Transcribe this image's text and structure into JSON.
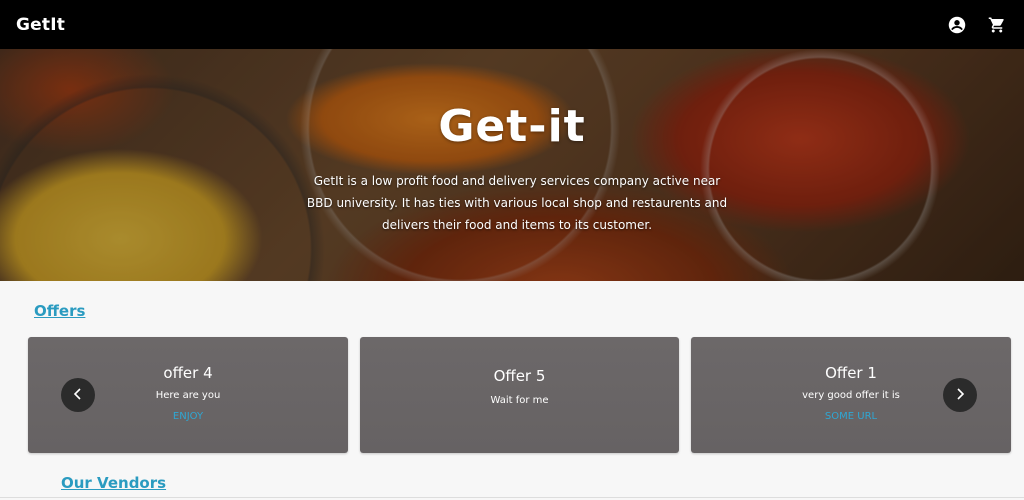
{
  "navbar": {
    "brand": "GetIt",
    "icons": [
      "account-circle-icon",
      "shopping-cart-icon"
    ]
  },
  "hero": {
    "title": "Get-it",
    "description": "GetIt is a low profit food and delivery services company active near BBD university. It has ties with various local shop and restaurents and delivers their food and items to its customer."
  },
  "offers": {
    "heading": "Offers",
    "cards": [
      {
        "title": "offer 4",
        "subtitle": "Here are you",
        "link": "ENJOY"
      },
      {
        "title": "Offer 5",
        "subtitle": "Wait for me",
        "link": ""
      },
      {
        "title": "Offer 1",
        "subtitle": "very good offer it is",
        "link": "SOME URL"
      }
    ],
    "prev_icon": "chevron-left-icon",
    "next_icon": "chevron-right-icon"
  },
  "vendors": {
    "heading": "Our Vendors"
  },
  "colors": {
    "navbar_bg": "#000000",
    "accent_link": "#2a9bc0",
    "card_bg": "#6a6667",
    "card_link": "#2fa7d3"
  }
}
